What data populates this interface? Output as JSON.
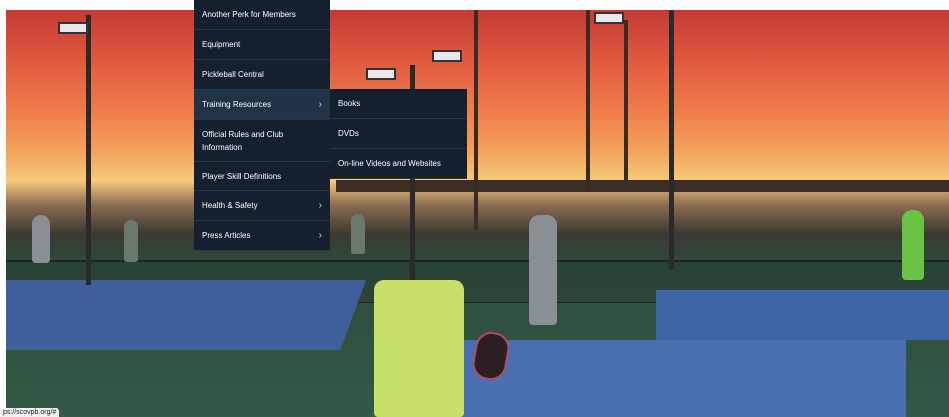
{
  "menu": {
    "items": [
      {
        "label": "Another Perk for Members",
        "has_submenu": false
      },
      {
        "label": "Equipment",
        "has_submenu": false
      },
      {
        "label": "Pickleball Central",
        "has_submenu": false
      },
      {
        "label": "Training Resources",
        "has_submenu": true
      },
      {
        "label": "Official Rules and Club Information",
        "has_submenu": false
      },
      {
        "label": "Player Skill Definitions",
        "has_submenu": false
      },
      {
        "label": "Health & Safety",
        "has_submenu": true
      },
      {
        "label": "Press Articles",
        "has_submenu": true
      }
    ],
    "chevron": "›"
  },
  "submenu": {
    "items": [
      {
        "label": "Books"
      },
      {
        "label": "DVDs"
      },
      {
        "label": "On-line Videos and Websites"
      }
    ]
  },
  "status_bar": {
    "url": "ps://scovpb.org/#"
  },
  "colors": {
    "menu_bg": "#14202e",
    "menu_active": "#223247",
    "menu_text": "#ffffff"
  }
}
